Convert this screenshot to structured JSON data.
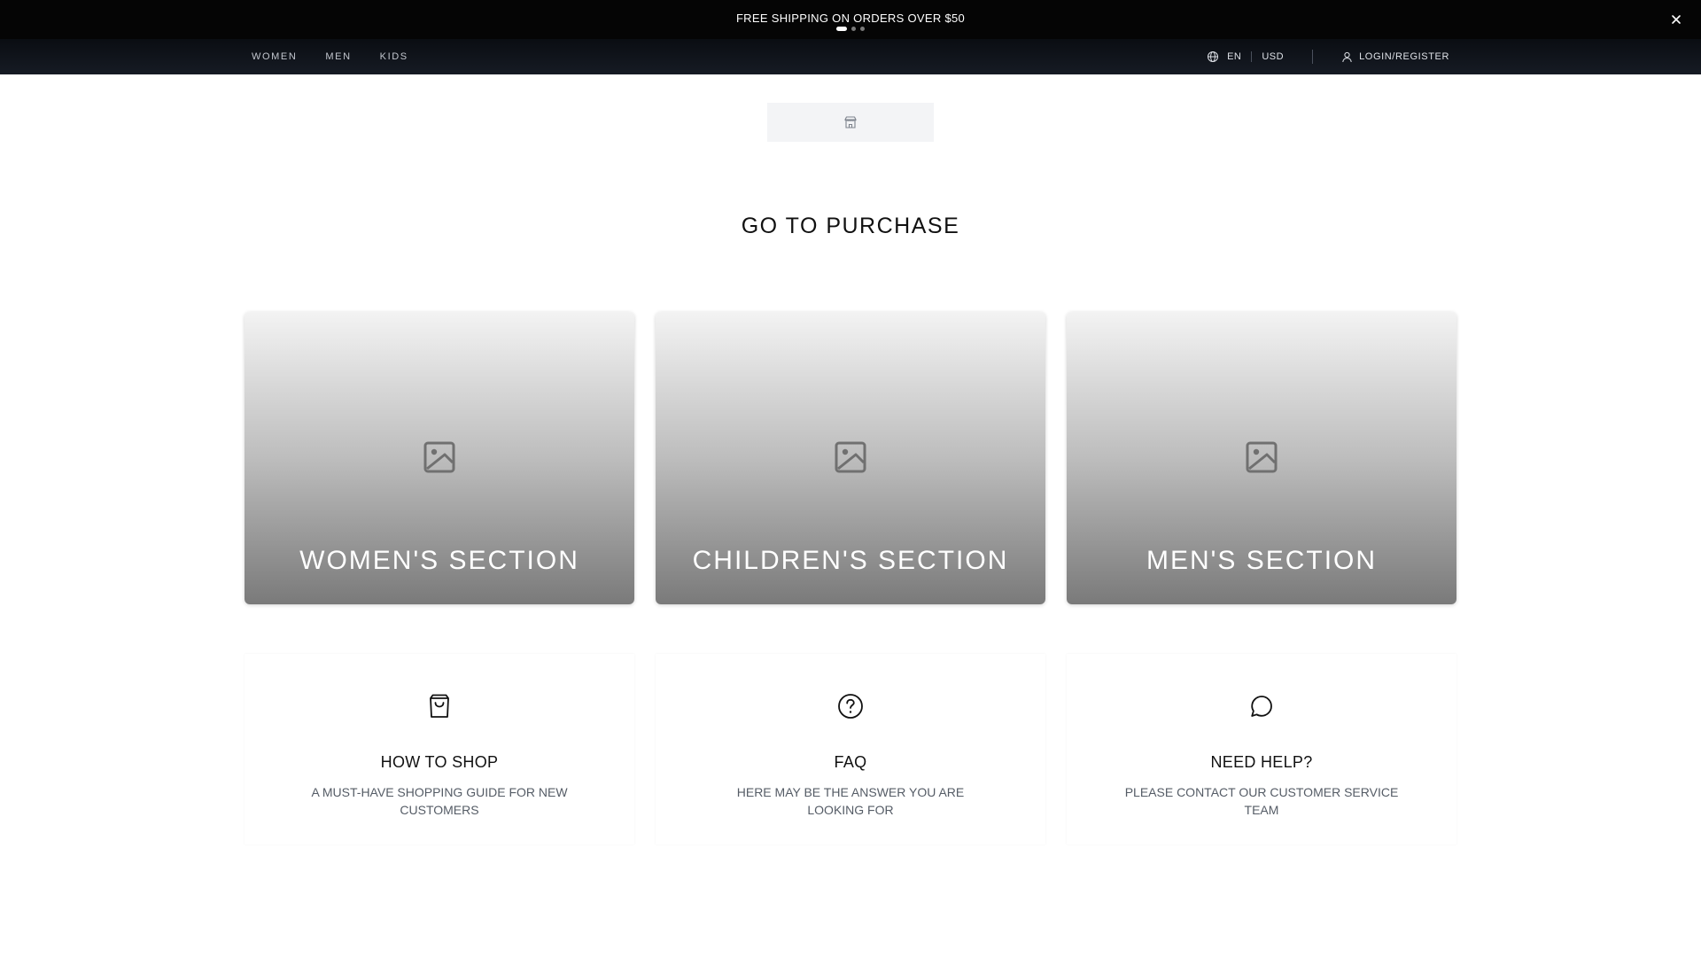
{
  "announcement": {
    "text": "FREE SHIPPING ON ORDERS OVER $50",
    "slide_count": 3,
    "active_slide": 1,
    "close_icon": "close-icon"
  },
  "nav": {
    "links": [
      "WOMEN",
      "MEN",
      "KIDS"
    ],
    "language": "EN",
    "currency": "USD",
    "login_label": "LOGIN/REGISTER",
    "icons": [
      "globe-icon",
      "user-icon"
    ]
  },
  "logo": {
    "icon": "store-icon"
  },
  "heading": "GO TO PURCHASE",
  "sections": [
    {
      "label": "WOMEN'S SECTION",
      "icon": "image-placeholder-icon"
    },
    {
      "label": "CHILDREN'S SECTION",
      "icon": "image-placeholder-icon"
    },
    {
      "label": "MEN'S SECTION",
      "icon": "image-placeholder-icon"
    }
  ],
  "info_blocks": [
    {
      "title": "HOW TO SHOP",
      "description": "A MUST-HAVE SHOPPING GUIDE FOR NEW CUSTOMERS",
      "icon": "shopping-bag-icon"
    },
    {
      "title": "FAQ",
      "description": "HERE MAY BE THE ANSWER YOU ARE LOOKING FOR",
      "icon": "help-circle-icon"
    },
    {
      "title": "NEED HELP?",
      "description": "PLEASE CONTACT OUR CUSTOMER SERVICE TEAM",
      "icon": "message-bubble-icon"
    }
  ],
  "colors": {
    "announcement_bg": "#050505",
    "nav_bg": "#10141b",
    "card_gradient_top": "#f3f3f3",
    "card_gradient_bottom": "#7a7a7a",
    "description_text": "#555c66"
  }
}
